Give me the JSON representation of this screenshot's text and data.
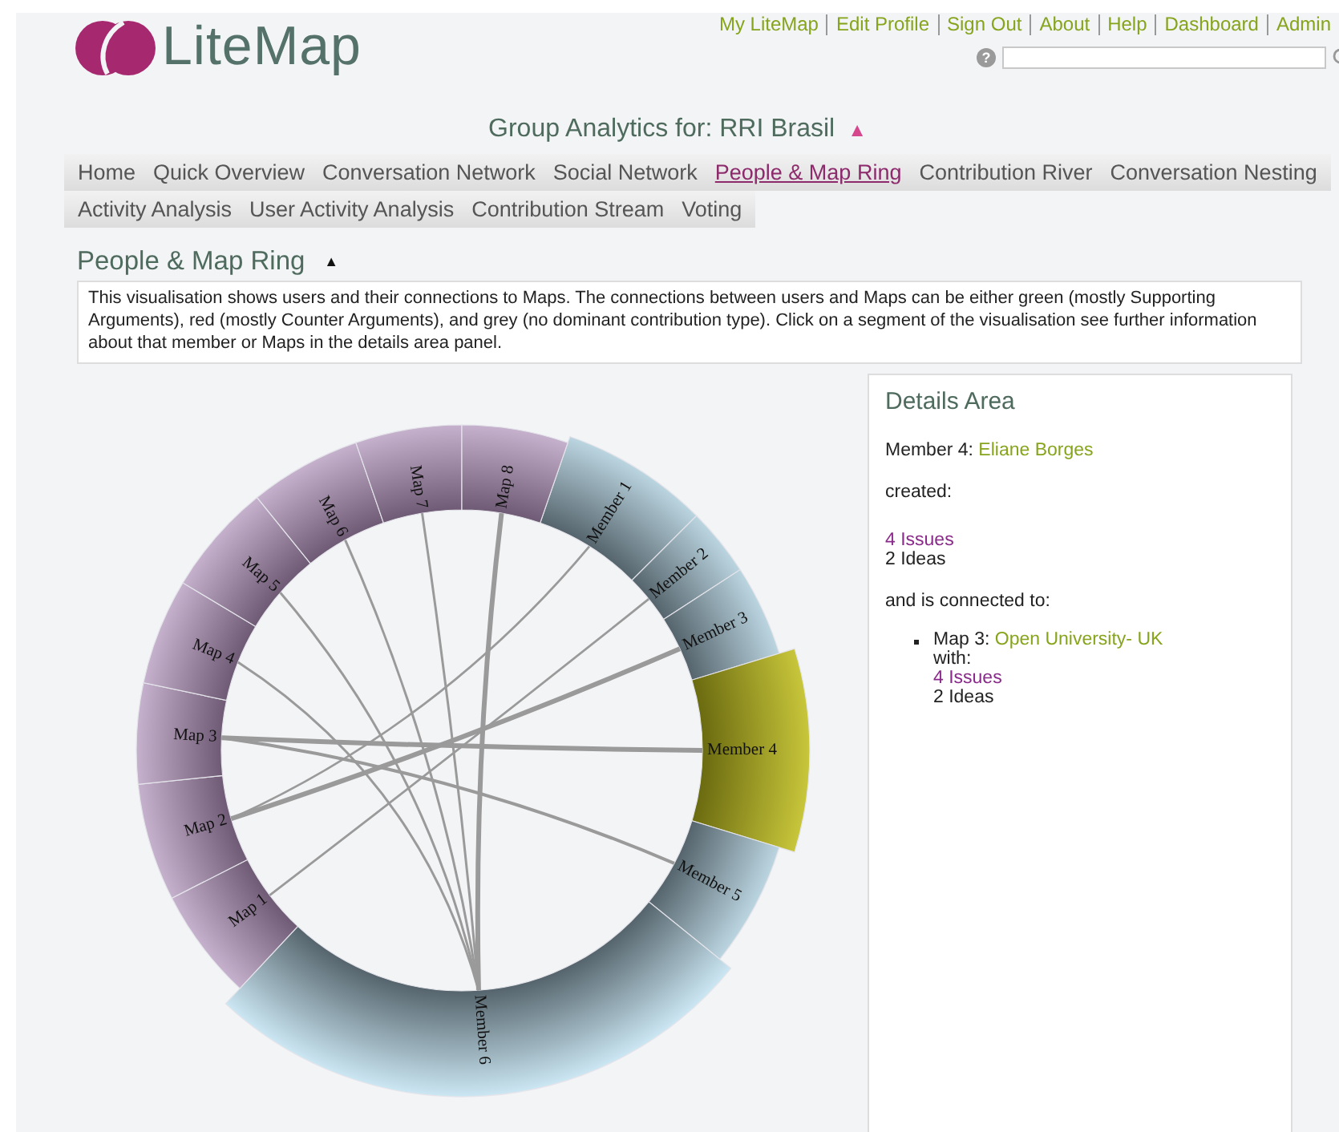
{
  "logo": {
    "text": "LiteMap"
  },
  "top_links": [
    "My LiteMap",
    "Edit Profile",
    "Sign Out",
    "About",
    "Help",
    "Dashboard",
    "Admin"
  ],
  "search": {
    "help": "?"
  },
  "page_title": {
    "text": "Group Analytics for: RRI Brasil",
    "toggle": "▲"
  },
  "tab_rows": [
    [
      {
        "label": "Home",
        "selected": false
      },
      {
        "label": "Quick Overview",
        "selected": false
      },
      {
        "label": "Conversation Network",
        "selected": false
      },
      {
        "label": "Social Network",
        "selected": false
      },
      {
        "label": "People & Map Ring",
        "selected": true
      },
      {
        "label": "Contribution River",
        "selected": false
      },
      {
        "label": "Conversation Nesting",
        "selected": false
      }
    ],
    [
      {
        "label": "Activity Analysis",
        "selected": false
      },
      {
        "label": "User Activity Analysis",
        "selected": false
      },
      {
        "label": "Contribution Stream",
        "selected": false
      },
      {
        "label": "Voting",
        "selected": false
      }
    ]
  ],
  "section": {
    "title": "People & Map Ring",
    "toggle": "▲",
    "description": "This visualisation shows users and their connections to Maps. The connections between users and Maps can be either green (mostly Supporting Arguments), red (mostly Counter Arguments), and grey (no dominant contribution type). Click on a segment of the visualisation see further information about that member or Maps in the details area panel."
  },
  "ring": {
    "segments": [
      {
        "label": "Member 1",
        "kind": "member",
        "selected": false
      },
      {
        "label": "Member 2",
        "kind": "member",
        "selected": false
      },
      {
        "label": "Member 3",
        "kind": "member",
        "selected": false
      },
      {
        "label": "Member 4",
        "kind": "member",
        "selected": true
      },
      {
        "label": "Member 5",
        "kind": "member",
        "selected": false
      },
      {
        "label": "Member 6",
        "kind": "member",
        "selected": false
      },
      {
        "label": "Map 1",
        "kind": "map",
        "selected": false
      },
      {
        "label": "Map 2",
        "kind": "map",
        "selected": false
      },
      {
        "label": "Map 3",
        "kind": "map",
        "selected": false
      },
      {
        "label": "Map 4",
        "kind": "map",
        "selected": false
      },
      {
        "label": "Map 5",
        "kind": "map",
        "selected": false
      },
      {
        "label": "Map 6",
        "kind": "map",
        "selected": false
      },
      {
        "label": "Map 7",
        "kind": "map",
        "selected": false
      },
      {
        "label": "Map 8",
        "kind": "map",
        "selected": false
      }
    ]
  },
  "details": {
    "title": "Details Area",
    "member_label": "Member 4:",
    "member_name": "Eliane Borges",
    "created_label": "created:",
    "created": [
      {
        "text": "4 Issues",
        "kind": "link"
      },
      {
        "text": "2 Ideas",
        "kind": "plain"
      }
    ],
    "connected_label": "and is connected to:",
    "connections": [
      {
        "label": "Map 3:",
        "name": "Open University- UK",
        "with_label": "with:",
        "items": [
          {
            "text": "4 Issues",
            "kind": "link"
          },
          {
            "text": "2 Ideas",
            "kind": "plain"
          }
        ]
      }
    ]
  }
}
